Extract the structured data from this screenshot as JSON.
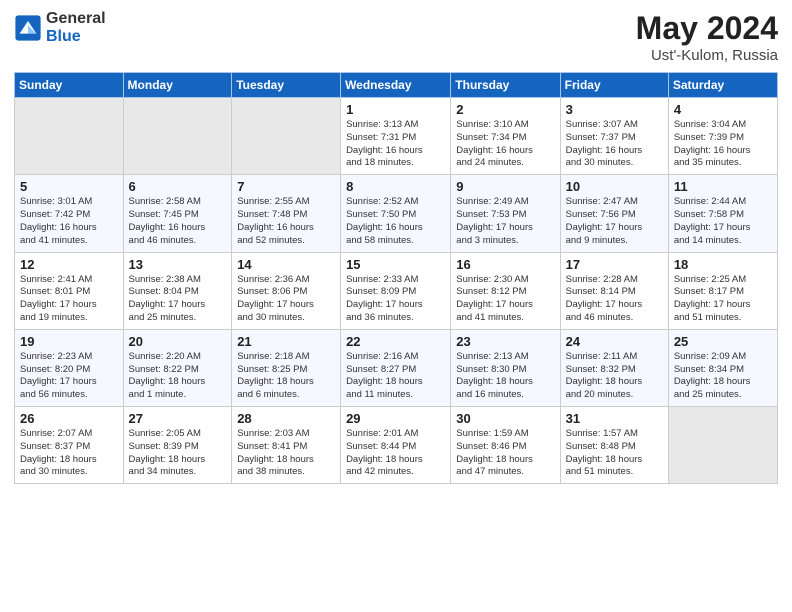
{
  "logo": {
    "general": "General",
    "blue": "Blue"
  },
  "title": "May 2024",
  "subtitle": "Ust'-Kulom, Russia",
  "days_of_week": [
    "Sunday",
    "Monday",
    "Tuesday",
    "Wednesday",
    "Thursday",
    "Friday",
    "Saturday"
  ],
  "weeks": [
    [
      {
        "day": "",
        "empty": true
      },
      {
        "day": "",
        "empty": true
      },
      {
        "day": "",
        "empty": true
      },
      {
        "day": "1",
        "info": "Sunrise: 3:13 AM\nSunset: 7:31 PM\nDaylight: 16 hours\nand 18 minutes."
      },
      {
        "day": "2",
        "info": "Sunrise: 3:10 AM\nSunset: 7:34 PM\nDaylight: 16 hours\nand 24 minutes."
      },
      {
        "day": "3",
        "info": "Sunrise: 3:07 AM\nSunset: 7:37 PM\nDaylight: 16 hours\nand 30 minutes."
      },
      {
        "day": "4",
        "info": "Sunrise: 3:04 AM\nSunset: 7:39 PM\nDaylight: 16 hours\nand 35 minutes."
      }
    ],
    [
      {
        "day": "5",
        "info": "Sunrise: 3:01 AM\nSunset: 7:42 PM\nDaylight: 16 hours\nand 41 minutes."
      },
      {
        "day": "6",
        "info": "Sunrise: 2:58 AM\nSunset: 7:45 PM\nDaylight: 16 hours\nand 46 minutes."
      },
      {
        "day": "7",
        "info": "Sunrise: 2:55 AM\nSunset: 7:48 PM\nDaylight: 16 hours\nand 52 minutes."
      },
      {
        "day": "8",
        "info": "Sunrise: 2:52 AM\nSunset: 7:50 PM\nDaylight: 16 hours\nand 58 minutes."
      },
      {
        "day": "9",
        "info": "Sunrise: 2:49 AM\nSunset: 7:53 PM\nDaylight: 17 hours\nand 3 minutes."
      },
      {
        "day": "10",
        "info": "Sunrise: 2:47 AM\nSunset: 7:56 PM\nDaylight: 17 hours\nand 9 minutes."
      },
      {
        "day": "11",
        "info": "Sunrise: 2:44 AM\nSunset: 7:58 PM\nDaylight: 17 hours\nand 14 minutes."
      }
    ],
    [
      {
        "day": "12",
        "info": "Sunrise: 2:41 AM\nSunset: 8:01 PM\nDaylight: 17 hours\nand 19 minutes."
      },
      {
        "day": "13",
        "info": "Sunrise: 2:38 AM\nSunset: 8:04 PM\nDaylight: 17 hours\nand 25 minutes."
      },
      {
        "day": "14",
        "info": "Sunrise: 2:36 AM\nSunset: 8:06 PM\nDaylight: 17 hours\nand 30 minutes."
      },
      {
        "day": "15",
        "info": "Sunrise: 2:33 AM\nSunset: 8:09 PM\nDaylight: 17 hours\nand 36 minutes."
      },
      {
        "day": "16",
        "info": "Sunrise: 2:30 AM\nSunset: 8:12 PM\nDaylight: 17 hours\nand 41 minutes."
      },
      {
        "day": "17",
        "info": "Sunrise: 2:28 AM\nSunset: 8:14 PM\nDaylight: 17 hours\nand 46 minutes."
      },
      {
        "day": "18",
        "info": "Sunrise: 2:25 AM\nSunset: 8:17 PM\nDaylight: 17 hours\nand 51 minutes."
      }
    ],
    [
      {
        "day": "19",
        "info": "Sunrise: 2:23 AM\nSunset: 8:20 PM\nDaylight: 17 hours\nand 56 minutes."
      },
      {
        "day": "20",
        "info": "Sunrise: 2:20 AM\nSunset: 8:22 PM\nDaylight: 18 hours\nand 1 minute."
      },
      {
        "day": "21",
        "info": "Sunrise: 2:18 AM\nSunset: 8:25 PM\nDaylight: 18 hours\nand 6 minutes."
      },
      {
        "day": "22",
        "info": "Sunrise: 2:16 AM\nSunset: 8:27 PM\nDaylight: 18 hours\nand 11 minutes."
      },
      {
        "day": "23",
        "info": "Sunrise: 2:13 AM\nSunset: 8:30 PM\nDaylight: 18 hours\nand 16 minutes."
      },
      {
        "day": "24",
        "info": "Sunrise: 2:11 AM\nSunset: 8:32 PM\nDaylight: 18 hours\nand 20 minutes."
      },
      {
        "day": "25",
        "info": "Sunrise: 2:09 AM\nSunset: 8:34 PM\nDaylight: 18 hours\nand 25 minutes."
      }
    ],
    [
      {
        "day": "26",
        "info": "Sunrise: 2:07 AM\nSunset: 8:37 PM\nDaylight: 18 hours\nand 30 minutes."
      },
      {
        "day": "27",
        "info": "Sunrise: 2:05 AM\nSunset: 8:39 PM\nDaylight: 18 hours\nand 34 minutes."
      },
      {
        "day": "28",
        "info": "Sunrise: 2:03 AM\nSunset: 8:41 PM\nDaylight: 18 hours\nand 38 minutes."
      },
      {
        "day": "29",
        "info": "Sunrise: 2:01 AM\nSunset: 8:44 PM\nDaylight: 18 hours\nand 42 minutes."
      },
      {
        "day": "30",
        "info": "Sunrise: 1:59 AM\nSunset: 8:46 PM\nDaylight: 18 hours\nand 47 minutes."
      },
      {
        "day": "31",
        "info": "Sunrise: 1:57 AM\nSunset: 8:48 PM\nDaylight: 18 hours\nand 51 minutes."
      },
      {
        "day": "",
        "empty": true
      }
    ]
  ]
}
